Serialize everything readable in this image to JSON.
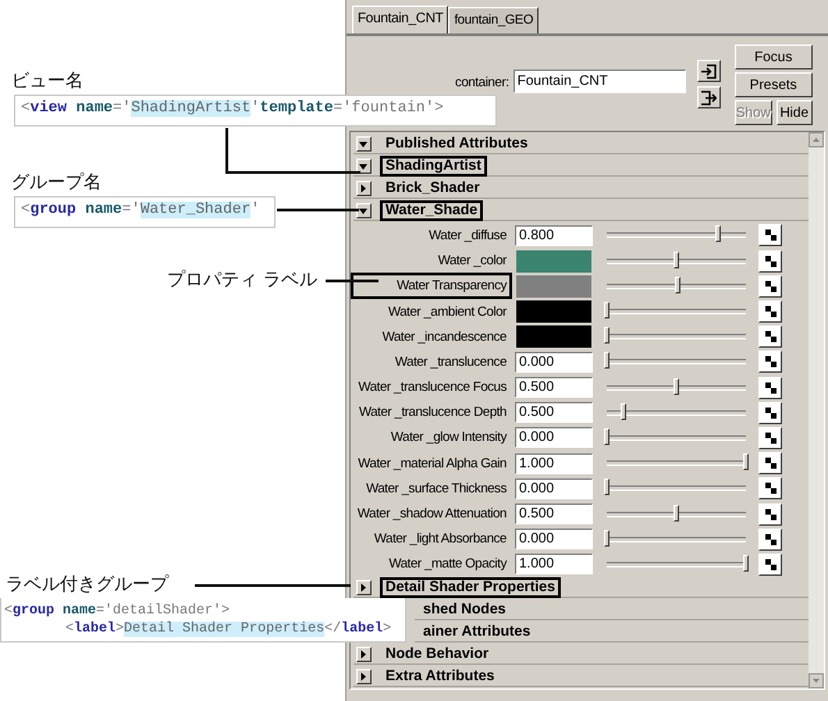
{
  "tabs": [
    {
      "label": "Fountain_CNT",
      "selected": true
    },
    {
      "label": "fountain_GEO",
      "selected": false
    }
  ],
  "container": {
    "label": "container:",
    "value": "Fountain_CNT"
  },
  "buttons": [
    {
      "label": "Focus",
      "disabled": false
    },
    {
      "label": "Presets",
      "disabled": false
    },
    {
      "label": "Show",
      "disabled": true
    },
    {
      "label": "Hide",
      "disabled": false
    }
  ],
  "rows": [
    {
      "kind": "section",
      "label": "Published Attributes",
      "expanded": true,
      "highlighted": false
    },
    {
      "kind": "section",
      "label": "ShadingArtist",
      "expanded": true,
      "highlighted": true
    },
    {
      "kind": "section",
      "label": "Brick_Shader",
      "expanded": false,
      "highlighted": false
    },
    {
      "kind": "section",
      "label": "Water_Shade",
      "expanded": true,
      "highlighted": true
    },
    {
      "kind": "number",
      "label": "Water _diffuse",
      "value": "0.800",
      "level": 0.8,
      "highlighted": false
    },
    {
      "kind": "swatch",
      "label": "Water _color",
      "color": "#3a8470",
      "level": 0.5,
      "highlighted": false
    },
    {
      "kind": "swatch",
      "label": "Water Transparency",
      "color": "#808080",
      "level": 0.51,
      "highlighted": true
    },
    {
      "kind": "swatch",
      "label": "Water _ambient Color",
      "color": "#000000",
      "level": 0,
      "highlighted": false
    },
    {
      "kind": "swatch",
      "label": "Water _incandescence",
      "color": "#000000",
      "level": 0,
      "highlighted": false
    },
    {
      "kind": "number",
      "label": "Water _translucence",
      "value": "0.000",
      "level": 0,
      "highlighted": false
    },
    {
      "kind": "number",
      "label": "Water _translucence Focus",
      "value": "0.500",
      "level": 0.5,
      "highlighted": false
    },
    {
      "kind": "number",
      "label": "Water _translucence Depth",
      "value": "0.500",
      "level": 0.12,
      "highlighted": false
    },
    {
      "kind": "number",
      "label": "Water _glow Intensity",
      "value": "0.000",
      "level": 0,
      "highlighted": false
    },
    {
      "kind": "number",
      "label": "Water _material Alpha Gain",
      "value": "1.000",
      "level": 1,
      "highlighted": false
    },
    {
      "kind": "number",
      "label": "Water _surface Thickness",
      "value": "0.000",
      "level": 0,
      "highlighted": false
    },
    {
      "kind": "number",
      "label": "Water _shadow Attenuation",
      "value": "0.500",
      "level": 0.5,
      "highlighted": false
    },
    {
      "kind": "number",
      "label": "Water _light Absorbance",
      "value": "0.000",
      "level": 0,
      "highlighted": false
    },
    {
      "kind": "number",
      "label": "Water _matte Opacity",
      "value": "1.000",
      "level": 1,
      "highlighted": false
    },
    {
      "kind": "section",
      "label": "Detail Shader Properties",
      "expanded": false,
      "highlighted": true
    },
    {
      "kind": "covered",
      "label": "shed Nodes"
    },
    {
      "kind": "covered",
      "label": "ainer Attributes"
    },
    {
      "kind": "section",
      "label": "Node Behavior",
      "expanded": false,
      "highlighted": false
    },
    {
      "kind": "section",
      "label": "Extra Attributes",
      "expanded": false,
      "highlighted": false
    }
  ],
  "callouts": [
    {
      "kind": "view",
      "title": "ビュー名",
      "code": [
        [
          {
            "kind": "punct",
            "text": "<"
          },
          {
            "kind": "tag",
            "text": "view"
          },
          {
            "kind": "attr",
            "text": " name"
          },
          {
            "kind": "punct",
            "text": "='"
          },
          {
            "kind": "value",
            "text": "ShadingArtist"
          },
          {
            "kind": "punct",
            "text": "'"
          },
          {
            "kind": "attr",
            "text": "template"
          },
          {
            "kind": "punct",
            "text": "='fountain'>"
          }
        ]
      ]
    },
    {
      "kind": "group",
      "title": "グループ名",
      "code": [
        [
          {
            "kind": "punct",
            "text": "<"
          },
          {
            "kind": "tag",
            "text": "group"
          },
          {
            "kind": "attr",
            "text": " name"
          },
          {
            "kind": "punct",
            "text": "='"
          },
          {
            "kind": "value",
            "text": "Water_Shader"
          },
          {
            "kind": "punct",
            "text": "'"
          }
        ]
      ]
    },
    {
      "kind": "property",
      "title": "プロパティ ラベル"
    },
    {
      "kind": "labeled",
      "title": "ラベル付きグループ",
      "code": [
        [
          {
            "kind": "punct",
            "text": "<"
          },
          {
            "kind": "tag",
            "text": "group"
          },
          {
            "kind": "attr",
            "text": " name"
          },
          {
            "kind": "punct",
            "text": "='detailShader'>"
          }
        ],
        [
          {
            "kind": "punct",
            "text": "<"
          },
          {
            "kind": "tag",
            "text": "label"
          },
          {
            "kind": "punct",
            "text": ">"
          },
          {
            "kind": "value",
            "text": "Detail Shader Properties"
          },
          {
            "kind": "punct",
            "text": "</"
          },
          {
            "kind": "tag",
            "text": "label"
          },
          {
            "kind": "punct",
            "text": ">"
          }
        ]
      ]
    }
  ]
}
